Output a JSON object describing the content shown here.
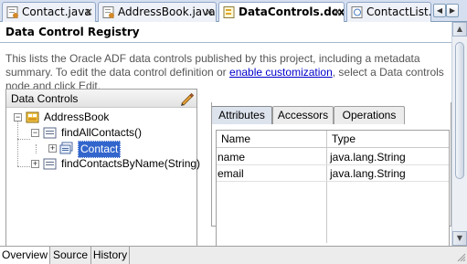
{
  "tabs": [
    {
      "label": "Contact.java",
      "active": false
    },
    {
      "label": "AddressBook.java",
      "active": false
    },
    {
      "label": "DataControls.dcx",
      "active": true
    },
    {
      "label": "ContactList.",
      "active": false
    }
  ],
  "tab_close": "×",
  "nav": {
    "left": "◀",
    "right": "▶",
    "menu": "▼"
  },
  "page_title": "Data Control Registry",
  "description": {
    "before_link": "This lists the Oracle ADF data controls published by this project, including a metadata summary. To edit the data control definition or ",
    "link": "enable customization",
    "after_link": ", select a Data controls node and click Edit."
  },
  "data_controls": {
    "header": "Data Controls",
    "tree": [
      {
        "label": "AddressBook",
        "icon": "datacontrol-icon",
        "expand": "−"
      },
      {
        "label": "findAllContacts()",
        "icon": "method-icon",
        "expand": "−"
      },
      {
        "label": "Contact",
        "icon": "collection-icon",
        "expand": "+",
        "selected": true
      },
      {
        "label": "findContactsByName(String)",
        "icon": "method-icon",
        "expand": "+"
      }
    ]
  },
  "detail_tabs": [
    {
      "label": "Attributes",
      "active": true
    },
    {
      "label": "Accessors",
      "active": false
    },
    {
      "label": "Operations",
      "active": false
    }
  ],
  "attributes_table": {
    "columns": [
      "Name",
      "Type"
    ],
    "rows": [
      [
        "name",
        "java.lang.String"
      ],
      [
        "email",
        "java.lang.String"
      ]
    ]
  },
  "bottom_tabs": [
    {
      "label": "Overview",
      "active": true
    },
    {
      "label": "Source",
      "active": false
    },
    {
      "label": "History",
      "active": false
    }
  ],
  "scroll": {
    "up": "▲",
    "down": "▼"
  }
}
